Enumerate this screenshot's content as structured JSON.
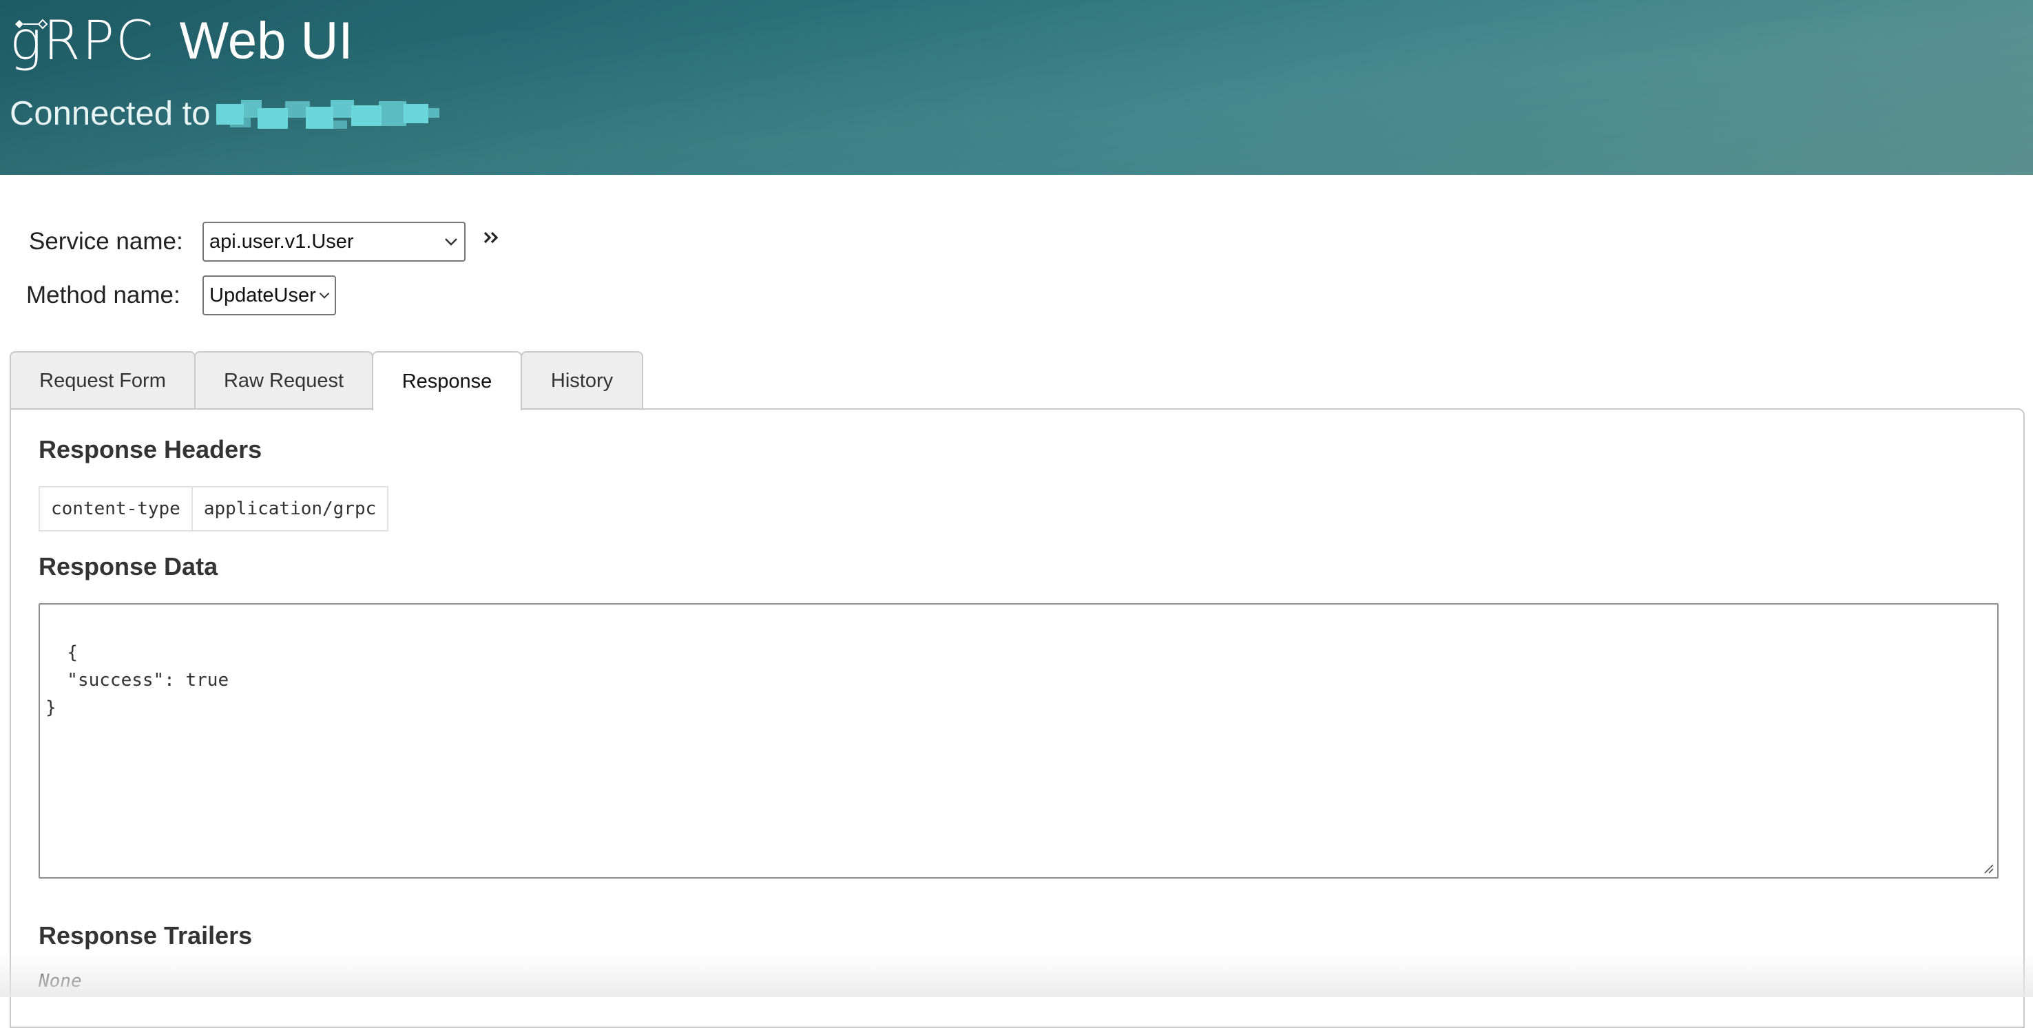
{
  "header": {
    "logo_text": "gRPC",
    "title": "Web UI",
    "connected_label": "Connected to"
  },
  "selectors": {
    "service_label": "Service name:",
    "service_value": "api.user.v1.User",
    "method_label": "Method name:",
    "method_value": "UpdateUser"
  },
  "tabs": [
    {
      "label": "Request Form"
    },
    {
      "label": "Raw Request"
    },
    {
      "label": "Response",
      "active": true
    },
    {
      "label": "History"
    }
  ],
  "response": {
    "headers_title": "Response Headers",
    "headers": [
      {
        "name": "content-type",
        "value": "application/grpc"
      }
    ],
    "data_title": "Response Data",
    "data_body": "{\n  \"success\": true\n}",
    "trailers_title": "Response Trailers",
    "trailers_value": "None"
  },
  "colors": {
    "header_gradient_start": "#1e5a64",
    "header_gradient_end": "#5a918f",
    "redacted": "#6bd6da"
  },
  "icons": {
    "expand": "double-chevron-right-icon",
    "dropdown": "chevron-down-icon",
    "resize": "resize-grip-icon"
  }
}
